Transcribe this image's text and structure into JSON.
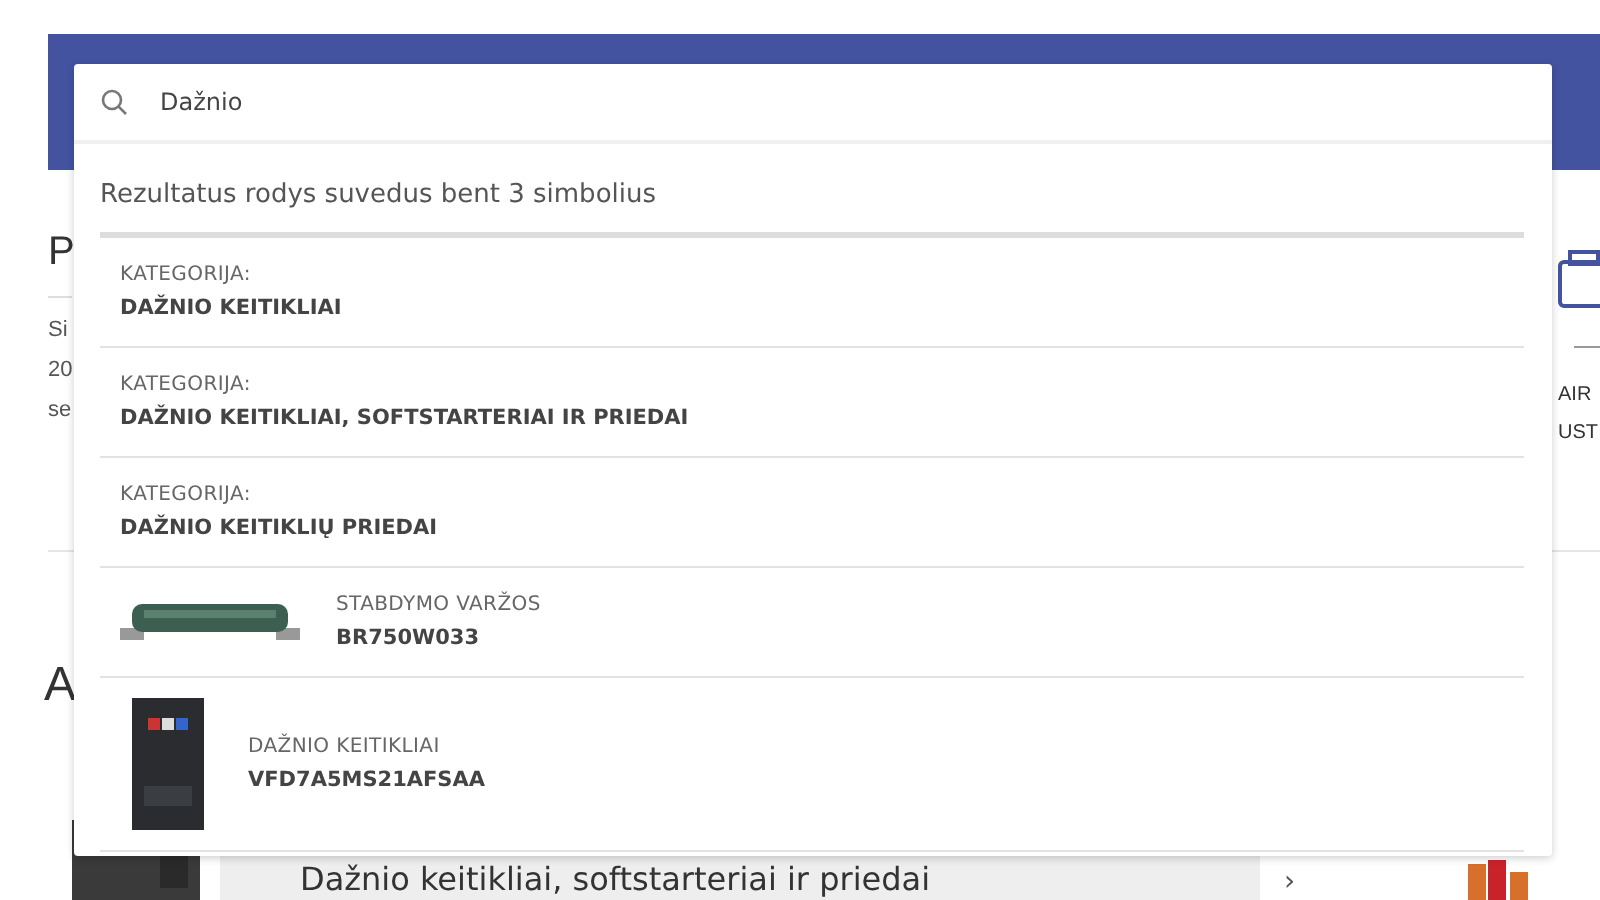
{
  "page": {
    "left_fragments": [
      {
        "kind": "heading",
        "text": "P"
      },
      {
        "kind": "line",
        "text": "Si"
      },
      {
        "kind": "line",
        "text": "20"
      },
      {
        "kind": "line",
        "text": "se"
      }
    ],
    "right_fragments": [
      "AIR",
      "UST"
    ],
    "section_fragment": "A",
    "card_title": "Dažnio keitikliai, softstarteriai ir priedai",
    "card_arrow": "›"
  },
  "search": {
    "value": "Dažnio"
  },
  "dropdown": {
    "hint": "Rezultatus rodys suvedus bent 3 simbolius",
    "results": [
      {
        "kind": "category",
        "label": "KATEGORIJA:",
        "title": "DAŽNIO KEITIKLIAI"
      },
      {
        "kind": "category",
        "label": "KATEGORIJA:",
        "title": "DAŽNIO KEITIKLIAI, SOFTSTARTERIAI IR PRIEDAI"
      },
      {
        "kind": "category",
        "label": "KATEGORIJA:",
        "title": "DAŽNIO KEITIKLIŲ PRIEDAI"
      },
      {
        "kind": "product",
        "label": "STABDYMO VARŽOS",
        "title": "BR750W033"
      },
      {
        "kind": "product",
        "label": "DAŽNIO KEITIKLIAI",
        "title": "VFD7A5MS21AFSAA"
      }
    ]
  }
}
